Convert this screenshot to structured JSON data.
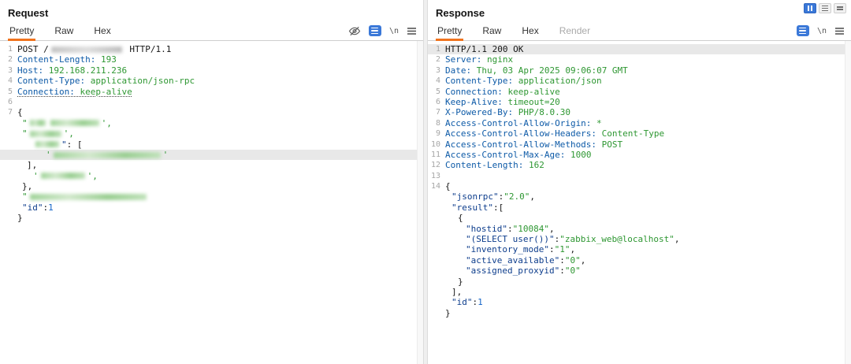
{
  "colors": {
    "accent-orange": "#f0731d",
    "header-name": "#0d5aa7",
    "value-green": "#2e9732",
    "json-key": "#0d3d8c",
    "number-blue": "#1464c8",
    "icon-blue": "#3a78d8",
    "redact-green": "#a6d69e",
    "redact-gray": "#c9c9c9",
    "highlight": "#e8e8e8"
  },
  "editor_icons": {
    "newline_label": "\\n"
  },
  "request": {
    "title": "Request",
    "tabs": [
      {
        "label": "Pretty",
        "active": true
      },
      {
        "label": "Raw",
        "active": false
      },
      {
        "label": "Hex",
        "active": false
      }
    ],
    "lines": [
      {
        "n": "1",
        "segs": [
          {
            "t": "POST /",
            "c": "p"
          },
          {
            "r": 90,
            "c": "gray"
          },
          {
            "t": " HTTP/1.1",
            "c": "p"
          }
        ]
      },
      {
        "n": "2",
        "segs": [
          {
            "t": "Content-Length:",
            "c": "hn"
          },
          {
            "t": " 193",
            "c": "hv"
          }
        ]
      },
      {
        "n": "3",
        "segs": [
          {
            "t": "Host:",
            "c": "hn"
          },
          {
            "t": " 192.168.211.236",
            "c": "hv"
          }
        ]
      },
      {
        "n": "4",
        "segs": [
          {
            "t": "Content-Type:",
            "c": "hn"
          },
          {
            "t": " application/json-rpc",
            "c": "hv"
          }
        ]
      },
      {
        "n": "5",
        "u": true,
        "segs": [
          {
            "t": "Connection:",
            "c": "hn"
          },
          {
            "t": " keep-alive",
            "c": "hv"
          }
        ]
      },
      {
        "n": "6",
        "segs": []
      },
      {
        "n": "7",
        "segs": [
          {
            "t": "{",
            "c": "p"
          }
        ]
      },
      {
        "ind": 6,
        "segs": [
          {
            "t": "\"",
            "c": "s"
          },
          {
            "r": 20,
            "c": "green"
          },
          {
            "r": 62,
            "c": "green"
          },
          {
            "t": "',",
            "c": "s"
          }
        ]
      },
      {
        "ind": 6,
        "segs": [
          {
            "t": "\"",
            "c": "s"
          },
          {
            "r": 40,
            "c": "green"
          },
          {
            "t": "',",
            "c": "s"
          }
        ]
      },
      {
        "ind": 20,
        "segs": [
          {
            "r": 30,
            "c": "green"
          },
          {
            "t": "\"",
            "c": "k"
          },
          {
            "t": ": [",
            "c": "p"
          }
        ]
      },
      {
        "ind": 36,
        "hl": true,
        "segs": [
          {
            "t": "'",
            "c": "s"
          },
          {
            "r": 136,
            "c": "green"
          },
          {
            "t": "'",
            "c": "s"
          }
        ]
      },
      {
        "ind": 12,
        "segs": [
          {
            "t": "],",
            "c": "p"
          }
        ]
      },
      {
        "ind": 20,
        "segs": [
          {
            "t": "'",
            "c": "s"
          },
          {
            "r": 56,
            "c": "green"
          },
          {
            "t": "',",
            "c": "s"
          }
        ]
      },
      {
        "ind": 6,
        "segs": [
          {
            "t": "},",
            "c": "p"
          }
        ]
      },
      {
        "ind": 6,
        "segs": [
          {
            "t": "\"",
            "c": "s"
          },
          {
            "r": 148,
            "c": "green"
          }
        ]
      },
      {
        "ind": 6,
        "segs": [
          {
            "t": "\"id\"",
            "c": "k"
          },
          {
            "t": ":",
            "c": "p"
          },
          {
            "t": "1",
            "c": "num"
          }
        ]
      },
      {
        "ind": 0,
        "segs": [
          {
            "t": "}",
            "c": "p"
          }
        ]
      }
    ]
  },
  "response": {
    "title": "Response",
    "tabs": [
      {
        "label": "Pretty",
        "active": true
      },
      {
        "label": "Raw",
        "active": false
      },
      {
        "label": "Hex",
        "active": false
      },
      {
        "label": "Render",
        "active": false,
        "disabled": true
      }
    ],
    "lines": [
      {
        "n": "1",
        "hl": true,
        "segs": [
          {
            "t": "HTTP/1.1 200 OK",
            "c": "p"
          }
        ]
      },
      {
        "n": "2",
        "segs": [
          {
            "t": "Server:",
            "c": "hn"
          },
          {
            "t": " nginx",
            "c": "hv"
          }
        ]
      },
      {
        "n": "3",
        "segs": [
          {
            "t": "Date:",
            "c": "hn"
          },
          {
            "t": " Thu, 03 Apr 2025 09:06:07 GMT",
            "c": "hv"
          }
        ]
      },
      {
        "n": "4",
        "segs": [
          {
            "t": "Content-Type:",
            "c": "hn"
          },
          {
            "t": " application/json",
            "c": "hv"
          }
        ]
      },
      {
        "n": "5",
        "segs": [
          {
            "t": "Connection:",
            "c": "hn"
          },
          {
            "t": " keep-alive",
            "c": "hv"
          }
        ]
      },
      {
        "n": "6",
        "segs": [
          {
            "t": "Keep-Alive:",
            "c": "hn"
          },
          {
            "t": " timeout=20",
            "c": "hv"
          }
        ]
      },
      {
        "n": "7",
        "segs": [
          {
            "t": "X-Powered-By:",
            "c": "hn"
          },
          {
            "t": " PHP/8.0.30",
            "c": "hv"
          }
        ]
      },
      {
        "n": "8",
        "segs": [
          {
            "t": "Access-Control-Allow-Origin:",
            "c": "hn"
          },
          {
            "t": " *",
            "c": "hv"
          }
        ]
      },
      {
        "n": "9",
        "segs": [
          {
            "t": "Access-Control-Allow-Headers:",
            "c": "hn"
          },
          {
            "t": " Content-Type",
            "c": "hv"
          }
        ]
      },
      {
        "n": "10",
        "segs": [
          {
            "t": "Access-Control-Allow-Methods:",
            "c": "hn"
          },
          {
            "t": " POST",
            "c": "hv"
          }
        ]
      },
      {
        "n": "11",
        "segs": [
          {
            "t": "Access-Control-Max-Age:",
            "c": "hn"
          },
          {
            "t": " 1000",
            "c": "hv"
          }
        ]
      },
      {
        "n": "12",
        "segs": [
          {
            "t": "Content-Length:",
            "c": "hn"
          },
          {
            "t": " 162",
            "c": "hv"
          }
        ]
      },
      {
        "n": "13",
        "segs": []
      },
      {
        "n": "14",
        "segs": [
          {
            "t": "{",
            "c": "p"
          }
        ]
      },
      {
        "ind": 8,
        "segs": [
          {
            "t": "\"jsonrpc\"",
            "c": "k"
          },
          {
            "t": ":",
            "c": "p"
          },
          {
            "t": "\"2.0\"",
            "c": "s"
          },
          {
            "t": ",",
            "c": "p"
          }
        ]
      },
      {
        "ind": 8,
        "segs": [
          {
            "t": "\"result\"",
            "c": "k"
          },
          {
            "t": ":[",
            "c": "p"
          }
        ]
      },
      {
        "ind": 16,
        "segs": [
          {
            "t": "{",
            "c": "p"
          }
        ]
      },
      {
        "ind": 26,
        "segs": [
          {
            "t": "\"hostid\"",
            "c": "k"
          },
          {
            "t": ":",
            "c": "p"
          },
          {
            "t": "\"10084\"",
            "c": "s"
          },
          {
            "t": ",",
            "c": "p"
          }
        ]
      },
      {
        "ind": 26,
        "segs": [
          {
            "t": "\"(SELECT user())\"",
            "c": "k"
          },
          {
            "t": ":",
            "c": "p"
          },
          {
            "t": "\"zabbix_web@localhost\"",
            "c": "s"
          },
          {
            "t": ",",
            "c": "p"
          }
        ]
      },
      {
        "ind": 26,
        "segs": [
          {
            "t": "\"inventory_mode\"",
            "c": "k"
          },
          {
            "t": ":",
            "c": "p"
          },
          {
            "t": "\"1\"",
            "c": "s"
          },
          {
            "t": ",",
            "c": "p"
          }
        ]
      },
      {
        "ind": 26,
        "segs": [
          {
            "t": "\"active_available\"",
            "c": "k"
          },
          {
            "t": ":",
            "c": "p"
          },
          {
            "t": "\"0\"",
            "c": "s"
          },
          {
            "t": ",",
            "c": "p"
          }
        ]
      },
      {
        "ind": 26,
        "segs": [
          {
            "t": "\"assigned_proxyid\"",
            "c": "k"
          },
          {
            "t": ":",
            "c": "p"
          },
          {
            "t": "\"0\"",
            "c": "s"
          }
        ]
      },
      {
        "ind": 16,
        "segs": [
          {
            "t": "}",
            "c": "p"
          }
        ]
      },
      {
        "ind": 8,
        "segs": [
          {
            "t": "],",
            "c": "p"
          }
        ]
      },
      {
        "ind": 8,
        "segs": [
          {
            "t": "\"id\"",
            "c": "k"
          },
          {
            "t": ":",
            "c": "p"
          },
          {
            "t": "1",
            "c": "num"
          }
        ]
      },
      {
        "ind": 0,
        "segs": [
          {
            "t": "}",
            "c": "p"
          }
        ]
      }
    ]
  }
}
